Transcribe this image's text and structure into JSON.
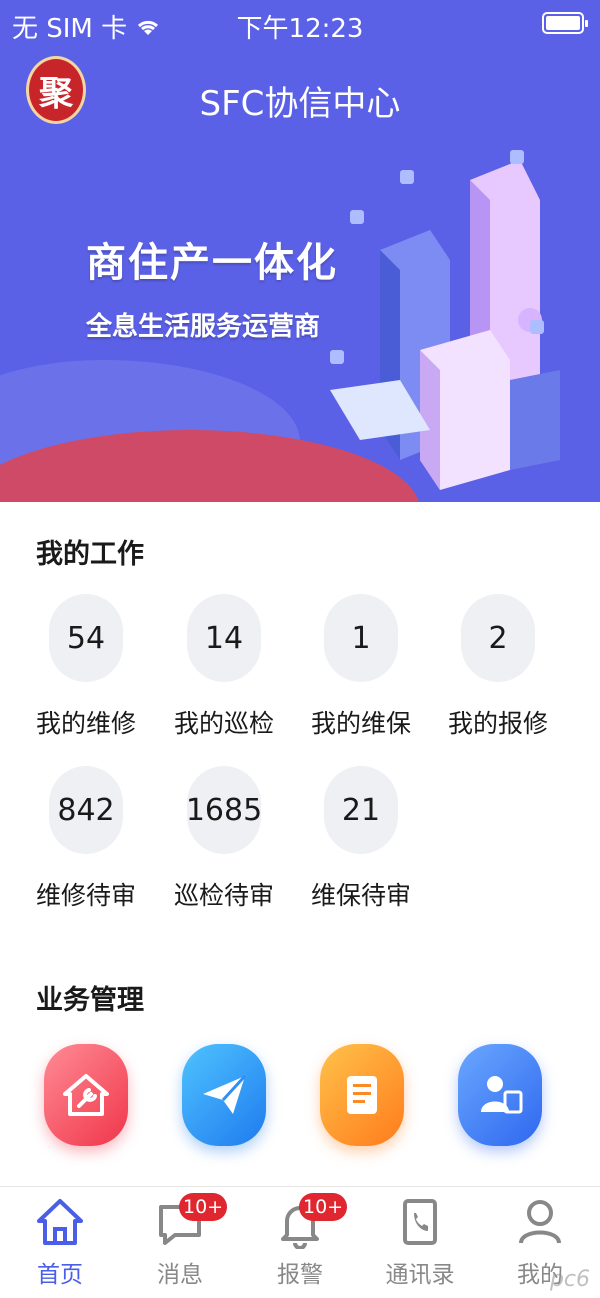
{
  "status_bar": {
    "carrier": "无 SIM 卡",
    "time": "下午12:23"
  },
  "header": {
    "logo_char": "聚",
    "title": "SFC协信中心"
  },
  "banner": {
    "slogan_main": "商住产一体化",
    "slogan_sub": "全息生活服务运营商"
  },
  "my_work": {
    "title": "我的工作",
    "items": [
      {
        "value": "54",
        "label": "我的维修"
      },
      {
        "value": "14",
        "label": "我的巡检"
      },
      {
        "value": "1",
        "label": "我的维保"
      },
      {
        "value": "2",
        "label": "我的报修"
      },
      {
        "value": "842",
        "label": "维修待审"
      },
      {
        "value": "1685",
        "label": "巡检待审"
      },
      {
        "value": "21",
        "label": "维保待审"
      }
    ]
  },
  "business": {
    "title": "业务管理",
    "items": [
      {
        "icon": "house-wrench-icon",
        "color": "#f0364a"
      },
      {
        "icon": "paper-plane-icon",
        "color": "#1f7bef"
      },
      {
        "icon": "document-icon",
        "color": "#ff7b1c"
      },
      {
        "icon": "person-clipboard-icon",
        "color": "#2f67ef"
      }
    ]
  },
  "tab_bar": {
    "items": [
      {
        "label": "首页",
        "icon": "home-icon",
        "active": true
      },
      {
        "label": "消息",
        "icon": "message-icon",
        "badge": "10+"
      },
      {
        "label": "报警",
        "icon": "bell-icon",
        "badge": "10+"
      },
      {
        "label": "通讯录",
        "icon": "contacts-icon"
      },
      {
        "label": "我的",
        "icon": "profile-icon"
      }
    ],
    "active_color": "#4a5ee8",
    "inactive_color": "#888888"
  },
  "watermark": "pc6"
}
